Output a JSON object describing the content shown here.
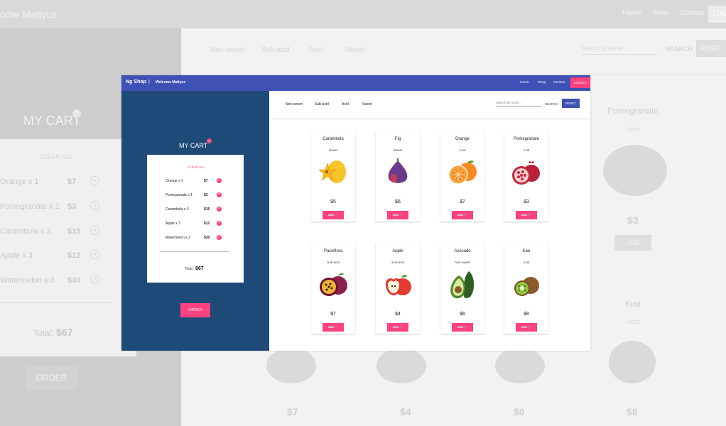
{
  "bg": {
    "brand": "ome Mattyus",
    "nav": [
      "Home",
      "Shop",
      "Contact"
    ],
    "logout": "LOG",
    "cart_title": "MY CART",
    "cart_badge": "5",
    "clear_all": "CLEAR ALL",
    "items": [
      {
        "name": "Orange x 1",
        "price": "$7"
      },
      {
        "name": "Pomegranate x 1",
        "price": "$3"
      },
      {
        "name": "Carambola x 3",
        "price": "$15"
      },
      {
        "name": "Apple x 3",
        "price": "$12"
      },
      {
        "name": "Watermelon x 3",
        "price": "$30"
      }
    ],
    "total_label": "Total:",
    "total_value": "$67",
    "order": "ORDER",
    "tabs": [
      "Non-sweet",
      "Sub-acid",
      "Acid",
      "Sweet"
    ],
    "search_placeholder": "Search by name...",
    "search": "SEARCH",
    "reset": "RESET",
    "products_right": [
      {
        "name": "Pomegranate",
        "type": "Acid",
        "price": "$3",
        "add": "ADD"
      },
      {
        "name": "Kiwi",
        "type": "Acid",
        "price": "$8"
      }
    ],
    "bottom_prices": [
      "$7",
      "$4",
      "$6",
      "$8"
    ]
  },
  "header": {
    "brand": "Ng Shop",
    "separator": "|",
    "welcome": "Welcome Mattyus",
    "nav": [
      "Home",
      "Shop",
      "Contact"
    ],
    "logout": "LOGOUT"
  },
  "cart": {
    "title": "MY CART",
    "badge": "5",
    "clear_all": "CLEAR ALL",
    "items": [
      {
        "name": "Orange x 1",
        "price": "$7"
      },
      {
        "name": "Pomegranate x 1",
        "price": "$3"
      },
      {
        "name": "Carambola x 3",
        "price": "$15"
      },
      {
        "name": "Apple x 3",
        "price": "$12"
      },
      {
        "name": "Watermelon x 3",
        "price": "$30"
      }
    ],
    "total_label": "Total:",
    "total_value": "$67",
    "order": "ORDER"
  },
  "filters": {
    "tabs": [
      "Non-sweet",
      "Sub-acid",
      "Acid",
      "Sweet"
    ],
    "search_placeholder": "Search by name...",
    "search": "SEARCH",
    "reset": "RESET"
  },
  "products": [
    {
      "name": "Carambola",
      "type": "Sweet",
      "price": "$5",
      "add": "ADD",
      "icon": "carambola-icon",
      "color": "#f4c02d"
    },
    {
      "name": "Fig",
      "type": "Sweet",
      "price": "$6",
      "add": "ADD",
      "icon": "fig-icon",
      "color": "#6a3b8c"
    },
    {
      "name": "Orange",
      "type": "Acid",
      "price": "$7",
      "add": "ADD",
      "icon": "orange-icon",
      "color": "#f7891f"
    },
    {
      "name": "Pomegranate",
      "type": "Acid",
      "price": "$3",
      "add": "ADD",
      "icon": "pomegranate-icon",
      "color": "#c4263a"
    },
    {
      "name": "Passiflora",
      "type": "Sub-acid",
      "price": "$7",
      "add": "ADD",
      "icon": "passiflora-icon",
      "color": "#8d1f4d"
    },
    {
      "name": "Apple",
      "type": "Sub-acid",
      "price": "$4",
      "add": "ADD",
      "icon": "apple-icon",
      "color": "#e23b2e"
    },
    {
      "name": "Avocado",
      "type": "Non-sweet",
      "price": "$6",
      "add": "ADD",
      "icon": "avocado-icon",
      "color": "#3f7a2c"
    },
    {
      "name": "Kiwi",
      "type": "Acid",
      "price": "$8",
      "add": "ADD",
      "icon": "kiwi-icon",
      "color": "#8b5a2b"
    }
  ]
}
